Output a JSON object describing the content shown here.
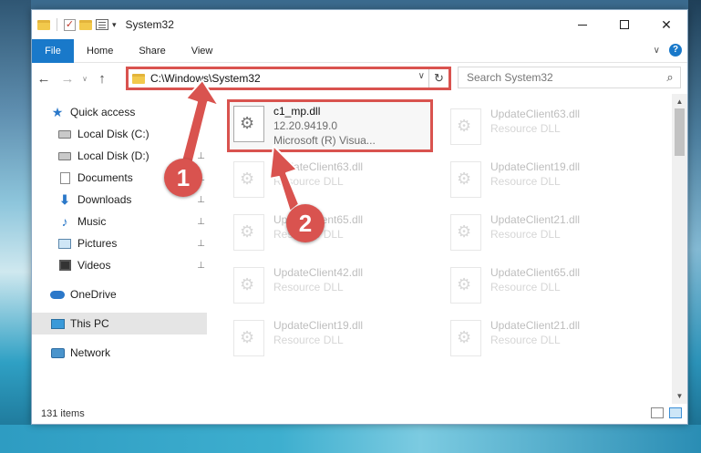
{
  "window": {
    "title": "System32",
    "min_symbol": "",
    "max_symbol": "",
    "close_symbol": "✕"
  },
  "ribbon": {
    "tabs": [
      "File",
      "Home",
      "Share",
      "View"
    ],
    "collapse_symbol": "∨",
    "help_symbol": "?"
  },
  "nav": {
    "back_symbol": "←",
    "forward_symbol": "→",
    "recent_symbol": "∨",
    "up_symbol": "↑",
    "address": "C:\\Windows\\System32",
    "address_dropdown_symbol": "∨",
    "refresh_symbol": "↻",
    "search_placeholder": "Search System32",
    "search_symbol": "⌕"
  },
  "sidebar": {
    "items": [
      {
        "label": "Quick access",
        "icon": "star-icon",
        "pinned": false
      },
      {
        "label": "Local Disk (C:)",
        "icon": "drive-icon",
        "pinned": false
      },
      {
        "label": "Local Disk (D:)",
        "icon": "drive-icon",
        "pinned": true
      },
      {
        "label": "Documents",
        "icon": "documents-icon",
        "pinned": true
      },
      {
        "label": "Downloads",
        "icon": "downloads-icon",
        "pinned": true
      },
      {
        "label": "Music",
        "icon": "music-icon",
        "pinned": true
      },
      {
        "label": "Pictures",
        "icon": "pictures-icon",
        "pinned": true
      },
      {
        "label": "Videos",
        "icon": "videos-icon",
        "pinned": true
      },
      {
        "label": "OneDrive",
        "icon": "onedrive-icon",
        "pinned": false
      },
      {
        "label": "This PC",
        "icon": "this-pc-icon",
        "pinned": false,
        "selected": true
      },
      {
        "label": "Network",
        "icon": "network-icon",
        "pinned": false
      }
    ],
    "pin_symbol": "📌"
  },
  "files": {
    "focused": {
      "name": "c1_mp.dll",
      "version": "12.20.9419.0",
      "company": "Microsoft (R) Visua..."
    },
    "left_column": [
      {
        "name": "UpdateClient63.dll",
        "type": "Resource DLL"
      },
      {
        "name": "UpdateClient65.dll",
        "type": "Resource DLL"
      },
      {
        "name": "UpdateClient42.dll",
        "type": "Resource DLL"
      },
      {
        "name": "UpdateClient19.dll",
        "type": "Resource DLL"
      }
    ],
    "right_column": [
      {
        "name": "UpdateClient63.dll",
        "type": "Resource DLL"
      },
      {
        "name": "UpdateClient19.dll",
        "type": "Resource DLL"
      },
      {
        "name": "UpdateClient21.dll",
        "type": "Resource DLL"
      },
      {
        "name": "UpdateClient65.dll",
        "type": "Resource DLL"
      },
      {
        "name": "UpdateClient21.dll",
        "type": "Resource DLL"
      }
    ]
  },
  "scrollbar": {
    "up_symbol": "▲",
    "down_symbol": "▼"
  },
  "status": {
    "item_count": "131 items"
  },
  "annotations": [
    {
      "label": "1",
      "color": "#d9534f"
    },
    {
      "label": "2",
      "color": "#d9534f"
    }
  ]
}
